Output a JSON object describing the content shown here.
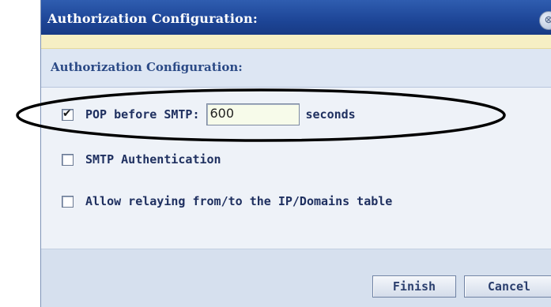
{
  "dialog": {
    "title": "Authorization Configuration:",
    "close_glyph": "⊗",
    "section_title": "Authorization Configuration:"
  },
  "options": {
    "pop_before_smtp": {
      "label": "POP before SMTP:",
      "checked": true,
      "value": "600",
      "unit": "seconds"
    },
    "smtp_auth": {
      "label": "SMTP Authentication",
      "checked": false
    },
    "allow_relaying": {
      "label": "Allow relaying from/to the IP/Domains table",
      "checked": false
    }
  },
  "footer": {
    "finish_label": "Finish",
    "cancel_label": "Cancel"
  },
  "colors": {
    "title_bar": "#1d4596",
    "highlight_ellipse": "#000000"
  }
}
